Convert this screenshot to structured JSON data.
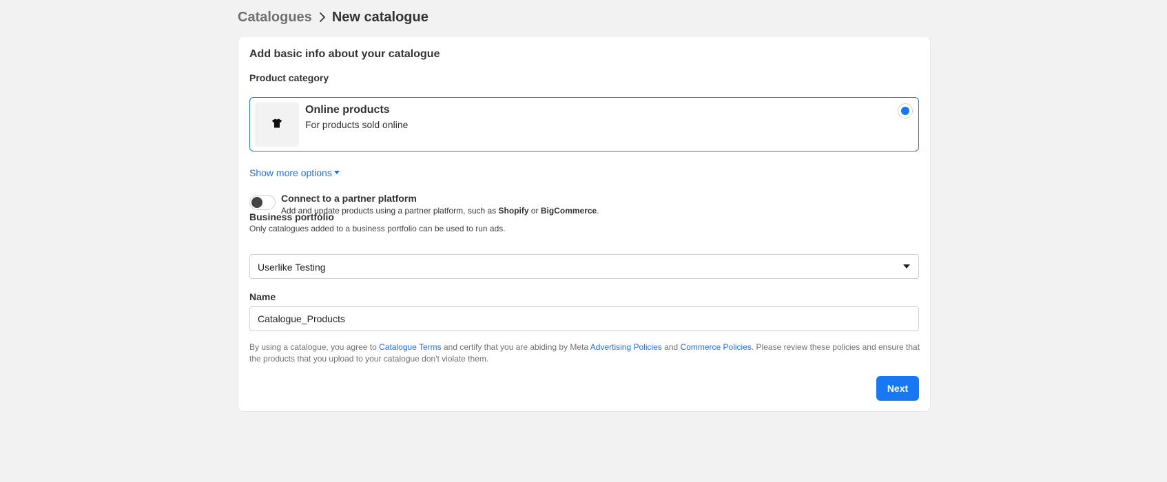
{
  "breadcrumb": {
    "parent": "Catalogues",
    "current": "New catalogue"
  },
  "card": {
    "title": "Add basic info about your catalogue"
  },
  "product_category": {
    "label": "Product category",
    "selected_option": {
      "title": "Online products",
      "subtitle": "For products sold online",
      "icon": "t-shirt-icon",
      "selected": true
    }
  },
  "show_more": {
    "label": "Show more options"
  },
  "partner": {
    "title": "Connect to a partner platform",
    "desc_prefix": "Add and update products using a partner platform, such as ",
    "platform_1": "Shopify",
    "desc_or": " or ",
    "platform_2": "BigCommerce",
    "desc_suffix": ".",
    "enabled": false
  },
  "business_portfolio": {
    "label": "Business portfolio",
    "helper": "Only catalogues added to a business portfolio can be used to run ads.",
    "value": "Userlike Testing"
  },
  "name_field": {
    "label": "Name",
    "value": "Catalogue_Products"
  },
  "terms": {
    "part1": "By using a catalogue, you agree to ",
    "link1": "Catalogue Terms",
    "part2": " and certify that you are abiding by Meta ",
    "link2": "Advertising Policies",
    "part3": " and ",
    "link3": "Commerce Policies",
    "part4": ". Please review these policies and ensure that the products that you upload to your catalogue don't violate them."
  },
  "actions": {
    "next_label": "Next"
  },
  "colors": {
    "accent": "#1877f2",
    "link": "#216fdb",
    "background": "#f2f2f2"
  }
}
